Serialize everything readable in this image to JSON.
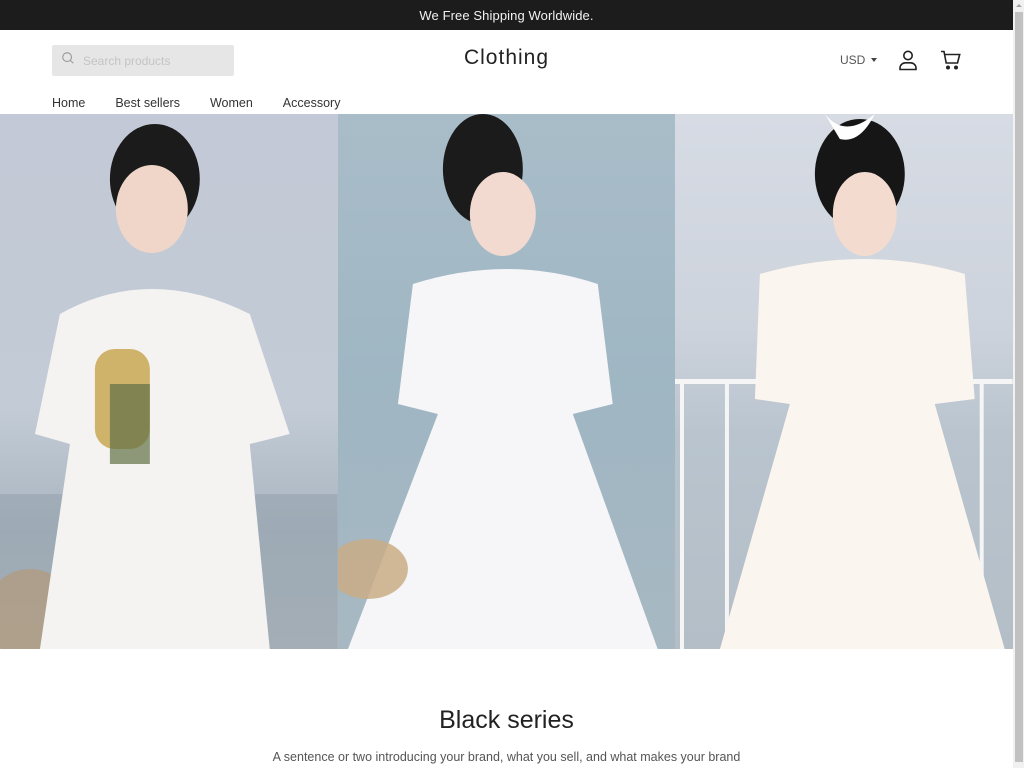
{
  "announcement": {
    "text": "We Free Shipping Worldwide."
  },
  "header": {
    "search": {
      "placeholder": "Search products",
      "value": "",
      "icon": "search-icon"
    },
    "logo": "Clothing",
    "currency": {
      "selected": "USD",
      "icon": "caret-down-icon"
    },
    "account_icon": "user-icon",
    "cart_icon": "cart-icon"
  },
  "nav": {
    "items": [
      {
        "label": "Home"
      },
      {
        "label": "Best sellers"
      },
      {
        "label": "Women"
      },
      {
        "label": "Accessory"
      }
    ]
  },
  "hero": {
    "panels": [
      {
        "alt": "Model in white eyelet dress holding flowers by the sea"
      },
      {
        "alt": "Model in white V-neck button dress by the sea"
      },
      {
        "alt": "Model in cream square-neck dress on a balcony"
      }
    ]
  },
  "intro": {
    "title": "Black series",
    "text": "A sentence or two introducing your brand, what you sell, and what makes your brand"
  }
}
